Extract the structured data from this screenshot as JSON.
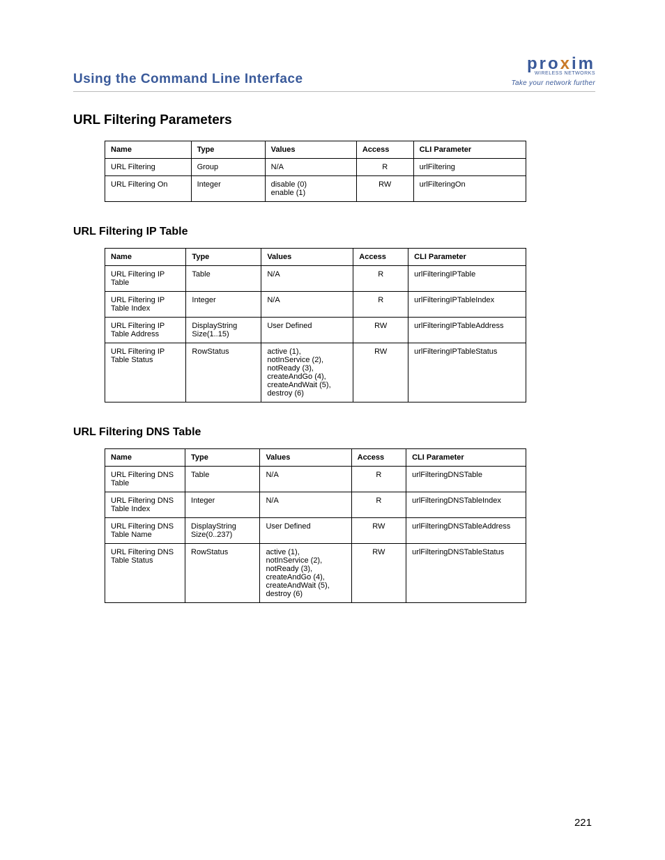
{
  "header": {
    "doc_title": "Using the Command Line Interface",
    "brand_main_pre": "pro",
    "brand_main_x": "x",
    "brand_main_post": "im",
    "brand_sub": "WIRELESS NETWORKS",
    "brand_tag": "Take your network further"
  },
  "page_number": "221",
  "section1": {
    "title": "URL Filtering Parameters",
    "headers": [
      "Name",
      "Type",
      "Values",
      "Access",
      "CLI Parameter"
    ],
    "rows": [
      {
        "name": "URL Filtering",
        "type": "Group",
        "values": "N/A",
        "access": "R",
        "cli": "urlFiltering"
      },
      {
        "name": "URL Filtering On",
        "type": "Integer",
        "values": "disable (0)\nenable (1)",
        "access": "RW",
        "cli": "urlFilteringOn"
      }
    ]
  },
  "section2": {
    "title": "URL Filtering IP Table",
    "headers": [
      "Name",
      "Type",
      "Values",
      "Access",
      "CLI Parameter"
    ],
    "rows": [
      {
        "name": "URL Filtering IP Table",
        "type": "Table",
        "values": "N/A",
        "access": "R",
        "cli": "urlFilteringIPTable"
      },
      {
        "name": "URL Filtering IP Table Index",
        "type": "Integer",
        "values": "N/A",
        "access": "R",
        "cli": "urlFilteringIPTableIndex"
      },
      {
        "name": "URL Filtering IP Table Address",
        "type": "DisplayString Size(1..15)",
        "values": "User Defined",
        "access": "RW",
        "cli": "urlFilteringIPTableAddress"
      },
      {
        "name": "URL Filtering IP Table Status",
        "type": "RowStatus",
        "values": "active (1),\nnotInService (2),\nnotReady (3),\ncreateAndGo (4),\ncreateAndWait (5),\ndestroy (6)",
        "access": "RW",
        "cli": "urlFilteringIPTableStatus"
      }
    ]
  },
  "section3": {
    "title": "URL Filtering DNS Table",
    "headers": [
      "Name",
      "Type",
      "Values",
      "Access",
      "CLI Parameter"
    ],
    "rows": [
      {
        "name": "URL Filtering DNS Table",
        "type": "Table",
        "values": "N/A",
        "access": "R",
        "cli": "urlFilteringDNSTable"
      },
      {
        "name": "URL Filtering DNS Table Index",
        "type": "Integer",
        "values": "N/A",
        "access": "R",
        "cli": "urlFilteringDNSTableIndex"
      },
      {
        "name": "URL Filtering DNS Table Name",
        "type": "DisplayString Size(0..237)",
        "values": "User Defined",
        "access": "RW",
        "cli": "urlFilteringDNSTableAddress"
      },
      {
        "name": "URL Filtering DNS Table Status",
        "type": "RowStatus",
        "values": "active (1),\nnotInService (2),\nnotReady (3),\ncreateAndGo (4),\ncreateAndWait (5),\ndestroy (6)",
        "access": "RW",
        "cli": "urlFilteringDNSTableStatus"
      }
    ]
  }
}
